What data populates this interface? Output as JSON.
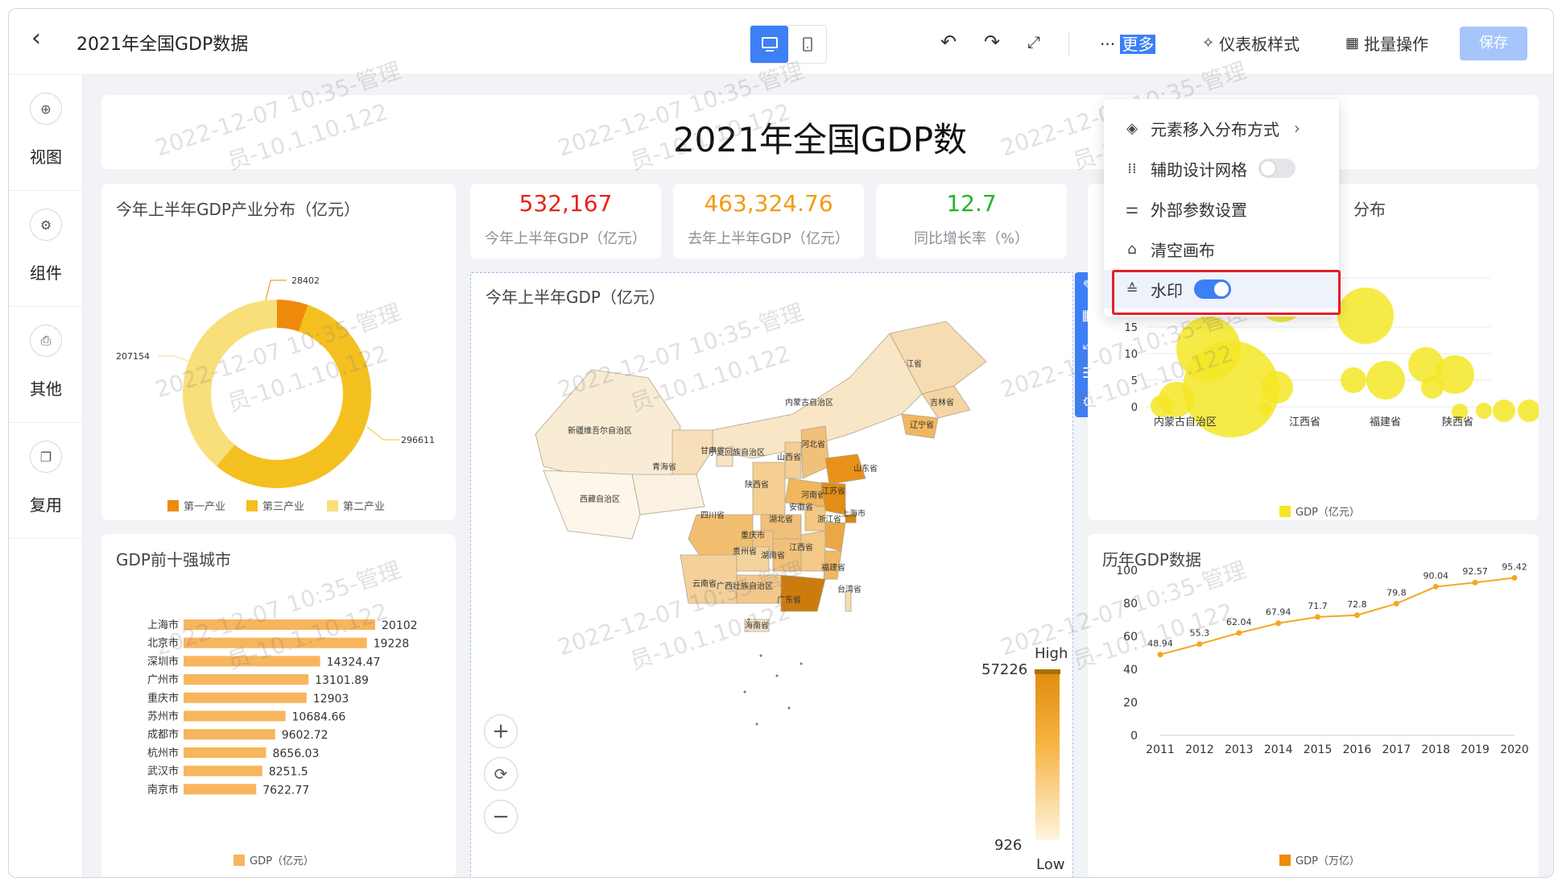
{
  "header": {
    "title": "2021年全国GDP数据",
    "more_prefix": "···",
    "more_label": "更多",
    "dashboard_style_label": "仪表板样式",
    "batch_label": "批量操作",
    "save_label": "保存"
  },
  "sidebar": {
    "items": [
      {
        "label": "视图"
      },
      {
        "label": "组件"
      },
      {
        "label": "其他"
      },
      {
        "label": "复用"
      }
    ]
  },
  "dashboard": {
    "title": "2021年全国GDP数"
  },
  "kpis": [
    {
      "value": "532,167",
      "label": "今年上半年GDP（亿元）",
      "color": "#e8231f"
    },
    {
      "value": "463,324.76",
      "label": "去年上半年GDP（亿元）",
      "color": "#f29b0f"
    },
    {
      "value": "12.7",
      "label": "同比增长率（%）",
      "color": "#27b427"
    }
  ],
  "donut": {
    "title": "今年上半年GDP产业分布（亿元）",
    "labels": [
      "28402",
      "207154",
      "296611"
    ],
    "legend": [
      "第一产业",
      "第三产业",
      "第二产业"
    ]
  },
  "bars": {
    "title": "GDP前十强城市",
    "legend": "GDP（亿元）"
  },
  "map": {
    "title": "今年上半年GDP（亿元）",
    "high_label": "High",
    "low_label": "Low",
    "max_value": "57226",
    "min_value": "926",
    "provinces": [
      "黑龙江省",
      "吉林省",
      "辽宁省",
      "内蒙古自治区",
      "新疆维吾尔自治区",
      "甘肃省",
      "宁夏回族自治区",
      "青海省",
      "西藏自治区",
      "山西省",
      "河北省",
      "山东省",
      "河南省",
      "陕西省",
      "四川省",
      "湖北省",
      "安徽省",
      "江苏省",
      "上海市",
      "浙江省",
      "重庆市",
      "贵州省",
      "湖南省",
      "江西省",
      "福建省",
      "云南省",
      "广西壮族自治区",
      "广东省",
      "台湾省",
      "海南省"
    ]
  },
  "bubble": {
    "title_suffix": "分布",
    "legend": "GDP（亿元）",
    "yticks": [
      "0",
      "5",
      "10",
      "15"
    ],
    "xticks": [
      "内蒙古自治区",
      "江西省",
      "福建省",
      "陕西省"
    ]
  },
  "line": {
    "title": "历年GDP数据",
    "legend": "GDP（万亿）"
  },
  "menu": {
    "items": [
      {
        "label": "元素移入分布方式",
        "icon": "layers-icon"
      },
      {
        "label": "辅助设计网格",
        "icon": "grid-dots-icon"
      },
      {
        "label": "外部参数设置",
        "icon": "sliders-icon"
      },
      {
        "label": "清空画布",
        "icon": "broom-icon"
      },
      {
        "label": "水印",
        "icon": "watermark-icon"
      }
    ],
    "grid_toggle_on": false,
    "watermark_toggle_on": true
  },
  "watermark": {
    "line1": "2022-12-07 10:35-管理",
    "line2": "员-10.1.10.122"
  },
  "chart_data": [
    {
      "type": "pie",
      "title": "今年上半年GDP产业分布（亿元）",
      "categories": [
        "第一产业",
        "第二产业",
        "第三产业"
      ],
      "values": [
        28402,
        296611,
        207154
      ],
      "colors": [
        "#ee8a0c",
        "#f4c020",
        "#f8df7a"
      ]
    },
    {
      "type": "bar",
      "title": "GDP前十强城市",
      "categories": [
        "上海市",
        "北京市",
        "深圳市",
        "广州市",
        "重庆市",
        "苏州市",
        "成都市",
        "杭州市",
        "武汉市",
        "南京市"
      ],
      "values": [
        20102,
        19228,
        14324.47,
        13101.89,
        12903,
        10684.66,
        9602.72,
        8656.03,
        8251.5,
        7622.77
      ],
      "value_labels": [
        "20102",
        "19228",
        "14324.47",
        "13101.89",
        "12903",
        "10684.66",
        "9602.72",
        "8656.03",
        "8251.5",
        "7622.77"
      ],
      "series": [
        {
          "name": "GDP（亿元）"
        }
      ],
      "color": "#f7b55e"
    },
    {
      "type": "line",
      "title": "历年GDP数据",
      "x": [
        "2011",
        "2012",
        "2013",
        "2014",
        "2015",
        "2016",
        "2017",
        "2018",
        "2019",
        "2020"
      ],
      "values": [
        48.94,
        55.3,
        62.04,
        67.94,
        71.7,
        72.8,
        79.8,
        90.04,
        92.57,
        95.42
      ],
      "value_labels": [
        "48.94",
        "55.3",
        "62.04",
        "67.94",
        "71.7",
        "72.8",
        "79.8",
        "90.04",
        "92.57",
        "95.42"
      ],
      "series": [
        {
          "name": "GDP（万亿）"
        }
      ],
      "ylim": [
        0,
        100
      ],
      "yticks": [
        "0",
        "20",
        "40",
        "60",
        "80",
        "100"
      ],
      "color": "#f5a623"
    }
  ]
}
